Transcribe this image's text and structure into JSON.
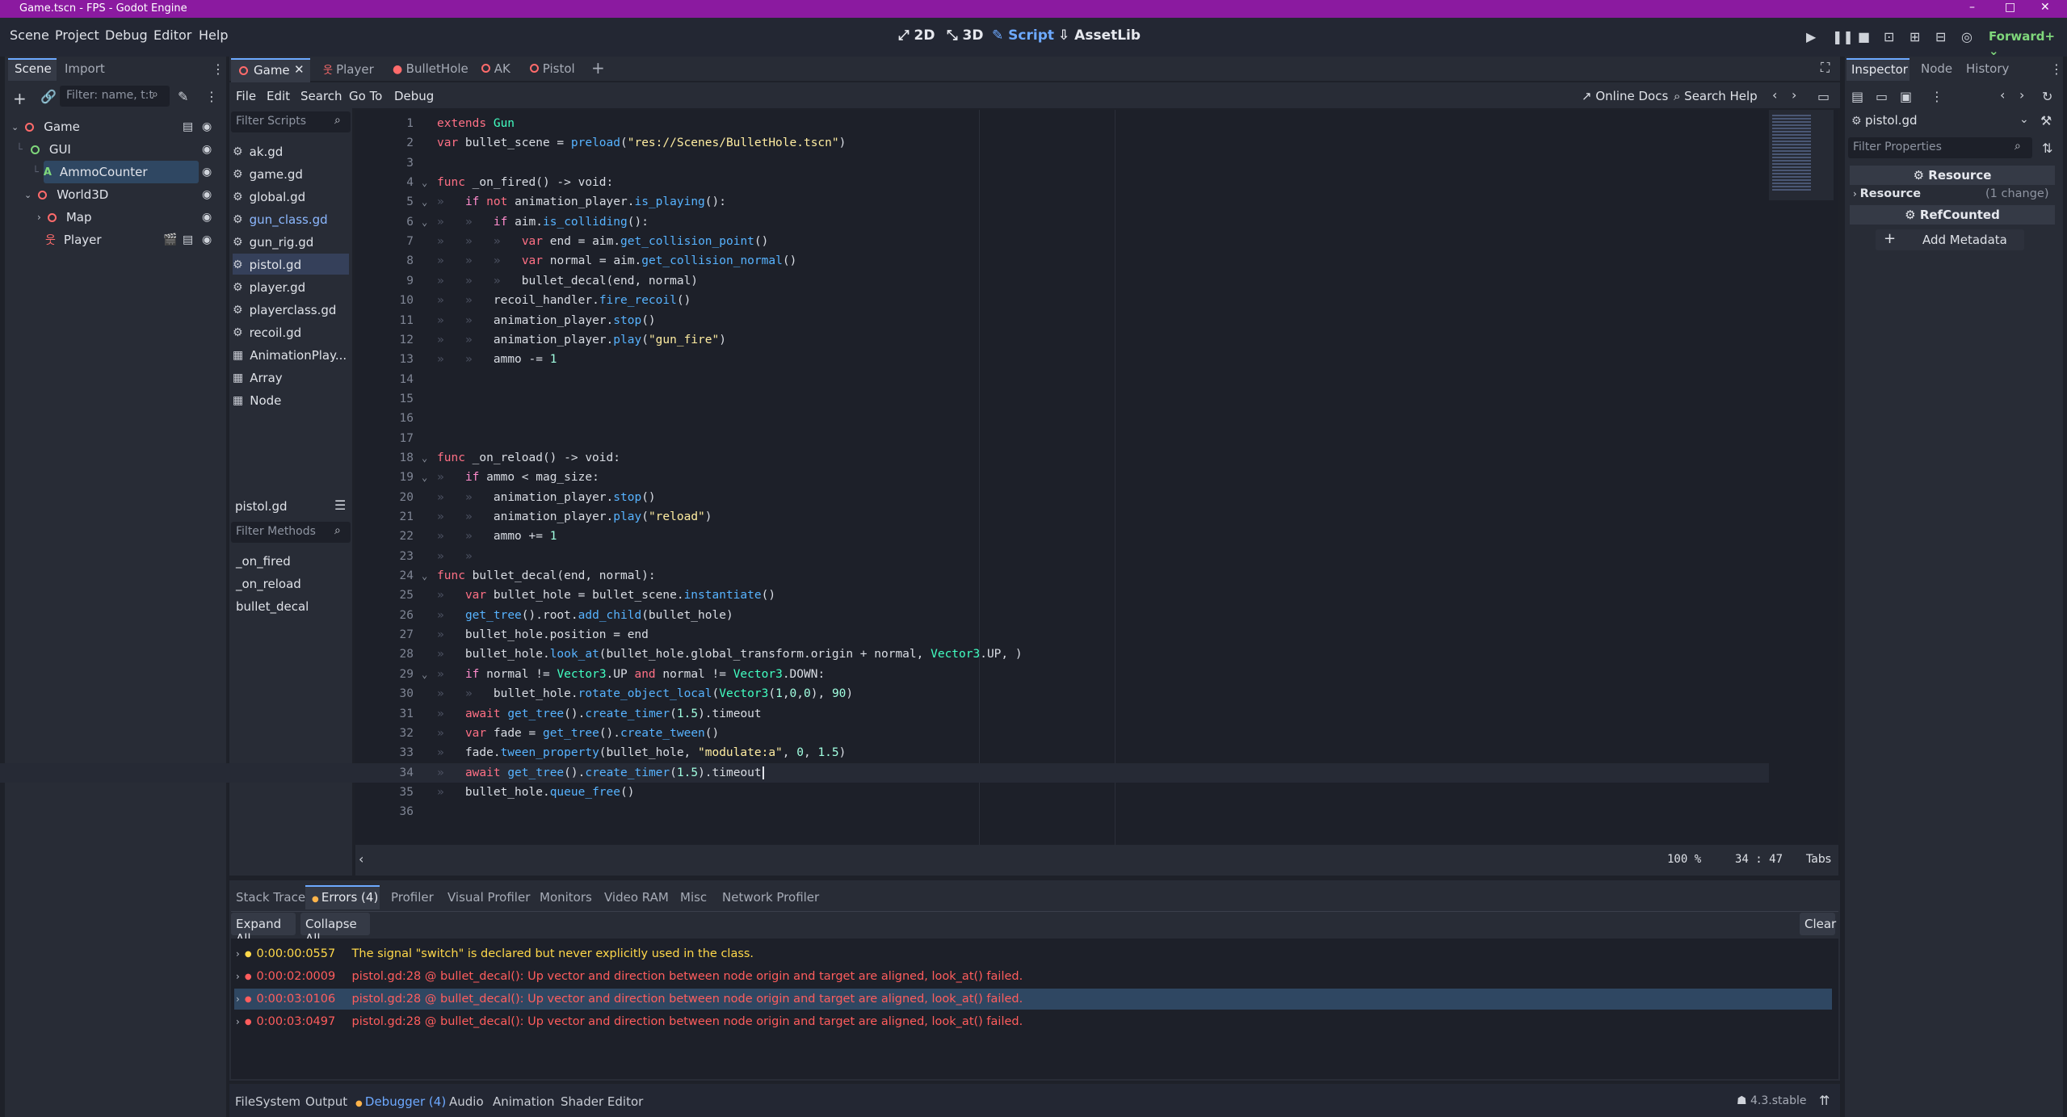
{
  "window": {
    "title": "Game.tscn - FPS - Godot Engine",
    "controls": [
      "–",
      "□",
      "✕"
    ]
  },
  "menubar": {
    "items": [
      "Scene",
      "Project",
      "Debug",
      "Editor",
      "Help"
    ],
    "main_tabs": [
      "2D",
      "3D",
      "Script",
      "AssetLib"
    ],
    "renderer": "Forward+"
  },
  "scene_dock": {
    "tabs": [
      "Scene",
      "Import"
    ],
    "filter_placeholder": "Filter: name, t:t",
    "tree": [
      {
        "label": "Game",
        "depth": 0
      },
      {
        "label": "GUI",
        "depth": 1
      },
      {
        "label": "AmmoCounter",
        "depth": 2,
        "selected": true
      },
      {
        "label": "World3D",
        "depth": 1
      },
      {
        "label": "Map",
        "depth": 2
      },
      {
        "label": "Player",
        "depth": 2
      }
    ]
  },
  "editor_tabs": [
    "Game",
    "Player",
    "BulletHole",
    "AK",
    "Pistol"
  ],
  "script_menu": [
    "File",
    "Edit",
    "Search",
    "Go To",
    "Debug"
  ],
  "script_toolbar": {
    "online_docs": "Online Docs",
    "search_help": "Search Help"
  },
  "script_list": {
    "filter_placeholder": "Filter Scripts",
    "items": [
      "ak.gd",
      "game.gd",
      "global.gd",
      "gun_class.gd",
      "gun_rig.gd",
      "pistol.gd",
      "player.gd",
      "playerclass.gd",
      "recoil.gd",
      "AnimationPlay...",
      "Array",
      "Node"
    ],
    "selected": "pistol.gd",
    "current_file": "pistol.gd",
    "methods_placeholder": "Filter Methods",
    "methods": [
      "_on_fired",
      "_on_reload",
      "bullet_decal"
    ]
  },
  "code_lines": [
    "extends Gun",
    "var bullet_scene = preload(\"res://Scenes/BulletHole.tscn\")",
    "",
    "func _on_fired() -> void:",
    "\tif not animation_player.is_playing():",
    "\t\tif aim.is_colliding():",
    "\t\t\tvar end = aim.get_collision_point()",
    "\t\t\tvar normal = aim.get_collision_normal()",
    "\t\t\tbullet_decal(end, normal)",
    "\t\trecoil_handler.fire_recoil()",
    "\t\tanimation_player.stop()",
    "\t\tanimation_player.play(\"gun_fire\")",
    "\t\tammo -= 1",
    "",
    "",
    "",
    "",
    "func _on_reload() -> void:",
    "\tif ammo < mag_size:",
    "\t\tanimation_player.stop()",
    "\t\tanimation_player.play(\"reload\")",
    "\t\tammo += 1",
    "\t\t",
    "func bullet_decal(end, normal):",
    "\tvar bullet_hole = bullet_scene.instantiate()",
    "\tget_tree().root.add_child(bullet_hole)",
    "\tbullet_hole.position = end",
    "\tbullet_hole.look_at(bullet_hole.global_transform.origin + normal, Vector3.UP, )",
    "\tif normal != Vector3.UP and normal != Vector3.DOWN:",
    "\t\tbullet_hole.rotate_object_local(Vector3(1,0,0), 90)",
    "\tawait get_tree().create_timer(1.5).timeout",
    "\tvar fade = get_tree().create_tween()",
    "\tfade.tween_property(bullet_hole, \"modulate:a\", 0, 1.5)",
    "\tawait get_tree().create_timer(1.5).timeout",
    "\tbullet_hole.queue_free()",
    ""
  ],
  "fold_lines": [
    4,
    5,
    6,
    18,
    19,
    24,
    29
  ],
  "current_line": 34,
  "status_bar": {
    "zoom": "100 %",
    "line": "34",
    "col": "47",
    "indent": "Tabs"
  },
  "debugger": {
    "tabs": [
      "Stack Trace",
      "Errors (4)",
      "Profiler",
      "Visual Profiler",
      "Monitors",
      "Video RAM",
      "Misc",
      "Network Profiler"
    ],
    "active_tab": "Errors (4)",
    "expand_all": "Expand All",
    "collapse_all": "Collapse All",
    "clear": "Clear",
    "errors": [
      {
        "time": "0:00:00:0557",
        "message": "The signal \"switch\" is declared but never explicitly used in the class.",
        "level": "warning"
      },
      {
        "time": "0:00:02:0009",
        "message": "pistol.gd:28 @ bullet_decal(): Up vector and direction between node origin and target are aligned, look_at() failed.",
        "level": "error"
      },
      {
        "time": "0:00:03:0106",
        "message": "pistol.gd:28 @ bullet_decal(): Up vector and direction between node origin and target are aligned, look_at() failed.",
        "level": "error",
        "selected": true
      },
      {
        "time": "0:00:03:0497",
        "message": "pistol.gd:28 @ bullet_decal(): Up vector and direction between node origin and target are aligned, look_at() failed.",
        "level": "error"
      }
    ]
  },
  "bottom_tabs": [
    "FileSystem",
    "Output",
    "Debugger (4)",
    "Audio",
    "Animation",
    "Shader Editor"
  ],
  "version": "4.3.stable",
  "inspector": {
    "tabs": [
      "Inspector",
      "Node",
      "History"
    ],
    "resource_name": "pistol.gd",
    "filter_placeholder": "Filter Properties",
    "section_resource": "Resource",
    "resource_row": "Resource",
    "resource_changes": "(1 change)",
    "refcounted": "RefCounted",
    "add_metadata": "Add Metadata"
  },
  "colors": {
    "titlebar": "#8b1aa0",
    "accent": "#6da9ff",
    "error": "#ff5d5d",
    "warning": "#ffd84a"
  }
}
